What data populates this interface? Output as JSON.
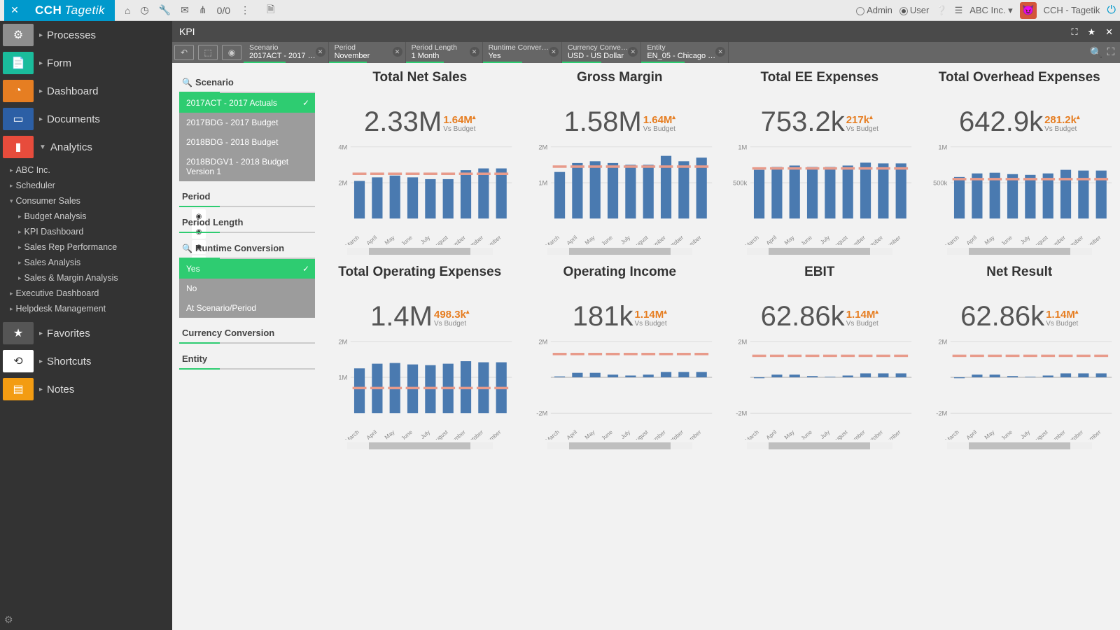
{
  "brand": {
    "prefix": "CCH",
    "suffix": "Tagetik"
  },
  "topbar": {
    "counter": "0/0",
    "role_admin": "Admin",
    "role_user": "User",
    "org": "ABC Inc.",
    "product": "CCH - Tagetik"
  },
  "sidebar_main": [
    {
      "label": "Processes",
      "cls": "col-proc",
      "g": "⚙"
    },
    {
      "label": "Form",
      "cls": "col-form",
      "g": "📄"
    },
    {
      "label": "Dashboard",
      "cls": "col-dash",
      "g": "◔"
    },
    {
      "label": "Documents",
      "cls": "col-doc",
      "g": "▭"
    },
    {
      "label": "Analytics",
      "cls": "col-ana",
      "g": "▮",
      "open": true
    }
  ],
  "sidebar_tree": {
    "top": [
      "ABC Inc.",
      "Scheduler"
    ],
    "group": "Consumer Sales",
    "items": [
      "Budget Analysis",
      "KPI Dashboard",
      "Sales Rep Performance",
      "Sales Analysis",
      "Sales & Margin Analysis"
    ],
    "bottom": [
      "Executive Dashboard",
      "Helpdesk Management"
    ]
  },
  "sidebar_extra": [
    {
      "label": "Favorites",
      "cls": "col-fav",
      "g": "★"
    },
    {
      "label": "Shortcuts",
      "cls": "col-sc",
      "g": "⟲"
    },
    {
      "label": "Notes",
      "cls": "col-note",
      "g": "▤"
    }
  ],
  "tab_title": "KPI",
  "crumbs": [
    {
      "t": "Scenario",
      "v": "2017ACT - 2017 …"
    },
    {
      "t": "Period",
      "v": "November"
    },
    {
      "t": "Period Length",
      "v": "1 Month"
    },
    {
      "t": "Runtime Conver…",
      "v": "Yes"
    },
    {
      "t": "Currency Conve…",
      "v": "USD - US Dollar"
    },
    {
      "t": "Entity",
      "v": "EN_05 - Chicago …"
    }
  ],
  "filters": {
    "scenario": {
      "label": "Scenario",
      "opts": [
        {
          "l": "2017ACT - 2017 Actuals",
          "sel": true
        },
        {
          "l": "2017BDG - 2017 Budget"
        },
        {
          "l": "2018BDG - 2018 Budget"
        },
        {
          "l": "2018BDGV1 - 2018 Budget Version 1"
        }
      ]
    },
    "period": {
      "label": "Period"
    },
    "period_len": {
      "label": "Period Length"
    },
    "runtime": {
      "label": "Runtime Conversion",
      "opts": [
        {
          "l": "Yes",
          "sel": true
        },
        {
          "l": "No"
        },
        {
          "l": "At Scenario/Period"
        }
      ]
    },
    "currency": {
      "label": "Currency Conversion"
    },
    "entity": {
      "label": "Entity"
    }
  },
  "kpis_row1": [
    {
      "title": "Total Net Sales",
      "main": "2.33M",
      "diff": "1.64M",
      "vs": "Vs Budget"
    },
    {
      "title": "Gross Margin",
      "main": "1.58M",
      "diff": "1.64M",
      "vs": "Vs Budget"
    },
    {
      "title": "Total EE Expenses",
      "main": "753.2k",
      "diff": "217k",
      "vs": "Vs Budget"
    },
    {
      "title": "Total Overhead Expenses",
      "main": "642.9k",
      "diff": "281.2k",
      "vs": "Vs Budget"
    }
  ],
  "kpis_row2": [
    {
      "title": "Total Operating Expenses",
      "main": "1.4M",
      "diff": "498.3k",
      "vs": "Vs Budget"
    },
    {
      "title": "Operating Income",
      "main": "181k",
      "diff": "1.14M",
      "vs": "Vs Budget"
    },
    {
      "title": "EBIT",
      "main": "62.86k",
      "diff": "1.14M",
      "vs": "Vs Budget"
    },
    {
      "title": "Net Result",
      "main": "62.86k",
      "diff": "1.14M",
      "vs": "Vs Budget"
    }
  ],
  "chart_data": {
    "months": [
      "March",
      "April",
      "May",
      "June",
      "July",
      "August",
      "September",
      "October",
      "November"
    ],
    "row1_ylabels": [
      "2M",
      "4M"
    ],
    "row1_ylabels_b": [
      "500k",
      "1M"
    ],
    "row2_ylabels": [
      "1M",
      "2M"
    ],
    "row2_ylabels_b": [
      "-2M",
      "2M"
    ],
    "series": {
      "net_sales": {
        "ymax": 4,
        "bars": [
          2.1,
          2.3,
          2.4,
          2.3,
          2.2,
          2.2,
          2.7,
          2.8,
          2.8
        ],
        "marks": [
          2.5,
          2.5,
          2.5,
          2.5,
          2.5,
          2.5,
          2.5,
          2.5,
          2.5
        ]
      },
      "gross_margin": {
        "ymax": 2,
        "bars": [
          1.3,
          1.55,
          1.6,
          1.55,
          1.5,
          1.5,
          1.75,
          1.6,
          1.7
        ],
        "marks": [
          1.45,
          1.45,
          1.45,
          1.45,
          1.45,
          1.45,
          1.45,
          1.45,
          1.45
        ]
      },
      "ee_exp": {
        "ymax": 1,
        "bars": [
          0.68,
          0.72,
          0.74,
          0.72,
          0.72,
          0.74,
          0.78,
          0.77,
          0.77
        ],
        "marks": [
          0.7,
          0.7,
          0.7,
          0.7,
          0.7,
          0.7,
          0.7,
          0.7,
          0.7
        ]
      },
      "overhead": {
        "ymax": 1,
        "bars": [
          0.58,
          0.63,
          0.64,
          0.62,
          0.61,
          0.63,
          0.68,
          0.67,
          0.67
        ],
        "marks": [
          0.55,
          0.55,
          0.55,
          0.55,
          0.55,
          0.55,
          0.55,
          0.55,
          0.55
        ]
      },
      "opex": {
        "ymax": 2,
        "bars": [
          1.25,
          1.38,
          1.4,
          1.36,
          1.34,
          1.38,
          1.45,
          1.42,
          1.42
        ],
        "marks": [
          0.7,
          0.7,
          0.7,
          0.7,
          0.7,
          0.7,
          0.7,
          0.7,
          0.7
        ]
      },
      "op_income": {
        "ymin": -2,
        "ymax": 2,
        "bars": [
          0.05,
          0.25,
          0.25,
          0.15,
          0.1,
          0.15,
          0.3,
          0.3,
          0.3
        ],
        "marks": [
          1.3,
          1.3,
          1.3,
          1.3,
          1.3,
          1.3,
          1.3,
          1.3,
          1.3
        ]
      },
      "ebit": {
        "ymin": -2,
        "ymax": 2,
        "bars": [
          -0.05,
          0.15,
          0.15,
          0.07,
          0.03,
          0.1,
          0.22,
          0.22,
          0.22
        ],
        "marks": [
          1.2,
          1.2,
          1.2,
          1.2,
          1.2,
          1.2,
          1.2,
          1.2,
          1.2
        ]
      },
      "net_result": {
        "ymin": -2,
        "ymax": 2,
        "bars": [
          -0.05,
          0.15,
          0.15,
          0.07,
          0.03,
          0.1,
          0.22,
          0.22,
          0.22
        ],
        "marks": [
          1.2,
          1.2,
          1.2,
          1.2,
          1.2,
          1.2,
          1.2,
          1.2,
          1.2
        ]
      }
    }
  }
}
